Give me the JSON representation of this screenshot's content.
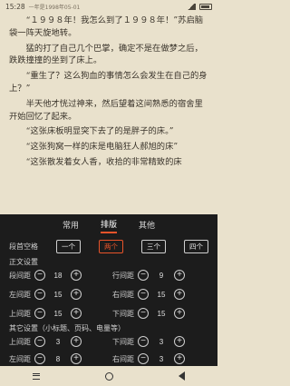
{
  "status": {
    "time": "15:28",
    "subtitle": "一年是1998年05-01",
    "signal_icon": "signal-icon",
    "battery_icon": "battery-icon"
  },
  "reader": {
    "paragraphs": [
      {
        "text": "“１９９８年！我怎么到了１９９８年！”苏启脑袋一阵天旋地转。",
        "cont": false
      },
      {
        "text": "猛的打了自己几个巴掌，确定不是在做梦之后，跌跌撞撞的坐到了床上。",
        "cont": false
      },
      {
        "text": "“重生了？这么狗血的事情怎么会发生在自己的身上？”",
        "cont": false
      },
      {
        "text": "半天他才恍过神来，然后望着这间熟悉的宿舍里开始回忆了起来。",
        "cont": false
      },
      {
        "text": "“这张床板明显突下去了的是胖子的床。”",
        "cont": false
      },
      {
        "text": "“这张狗窝一样的床是电脑狂人郝旭的床”",
        "cont": false
      },
      {
        "text": "“这张散发着女人香，收拾的非常精致的床",
        "cont": false
      }
    ]
  },
  "panel": {
    "tabs": [
      {
        "label": "常用",
        "active": false
      },
      {
        "label": "排版",
        "active": true
      },
      {
        "label": "其他",
        "active": false
      }
    ],
    "indent": {
      "label": "段首空格",
      "options": [
        {
          "label": "一个",
          "active": false
        },
        {
          "label": "两个",
          "active": true
        },
        {
          "label": "三个",
          "active": false
        },
        {
          "label": "四个",
          "active": false
        }
      ]
    },
    "body_section": "正文设置",
    "body_rows": [
      {
        "left": {
          "label": "段间距",
          "value": "18"
        },
        "right": {
          "label": "行间距",
          "value": "9"
        }
      },
      {
        "left": {
          "label": "左间距",
          "value": "15"
        },
        "right": {
          "label": "右间距",
          "value": "15"
        }
      },
      {
        "left": {
          "label": "上间距",
          "value": "15"
        },
        "right": {
          "label": "下间距",
          "value": "15"
        }
      }
    ],
    "other_section": "其它设置（小标题、页码、电量等）",
    "other_rows": [
      {
        "left": {
          "label": "上间距",
          "value": "3"
        },
        "right": {
          "label": "下间距",
          "value": "3"
        }
      },
      {
        "left": {
          "label": "左间距",
          "value": "8"
        },
        "right": {
          "label": "右间距",
          "value": "3"
        }
      }
    ],
    "minus_icon": "minus-circle-icon",
    "plus_icon": "plus-circle-icon"
  },
  "navbar": {
    "menu_icon": "menu-icon",
    "home_icon": "home-icon",
    "back_icon": "back-icon"
  }
}
